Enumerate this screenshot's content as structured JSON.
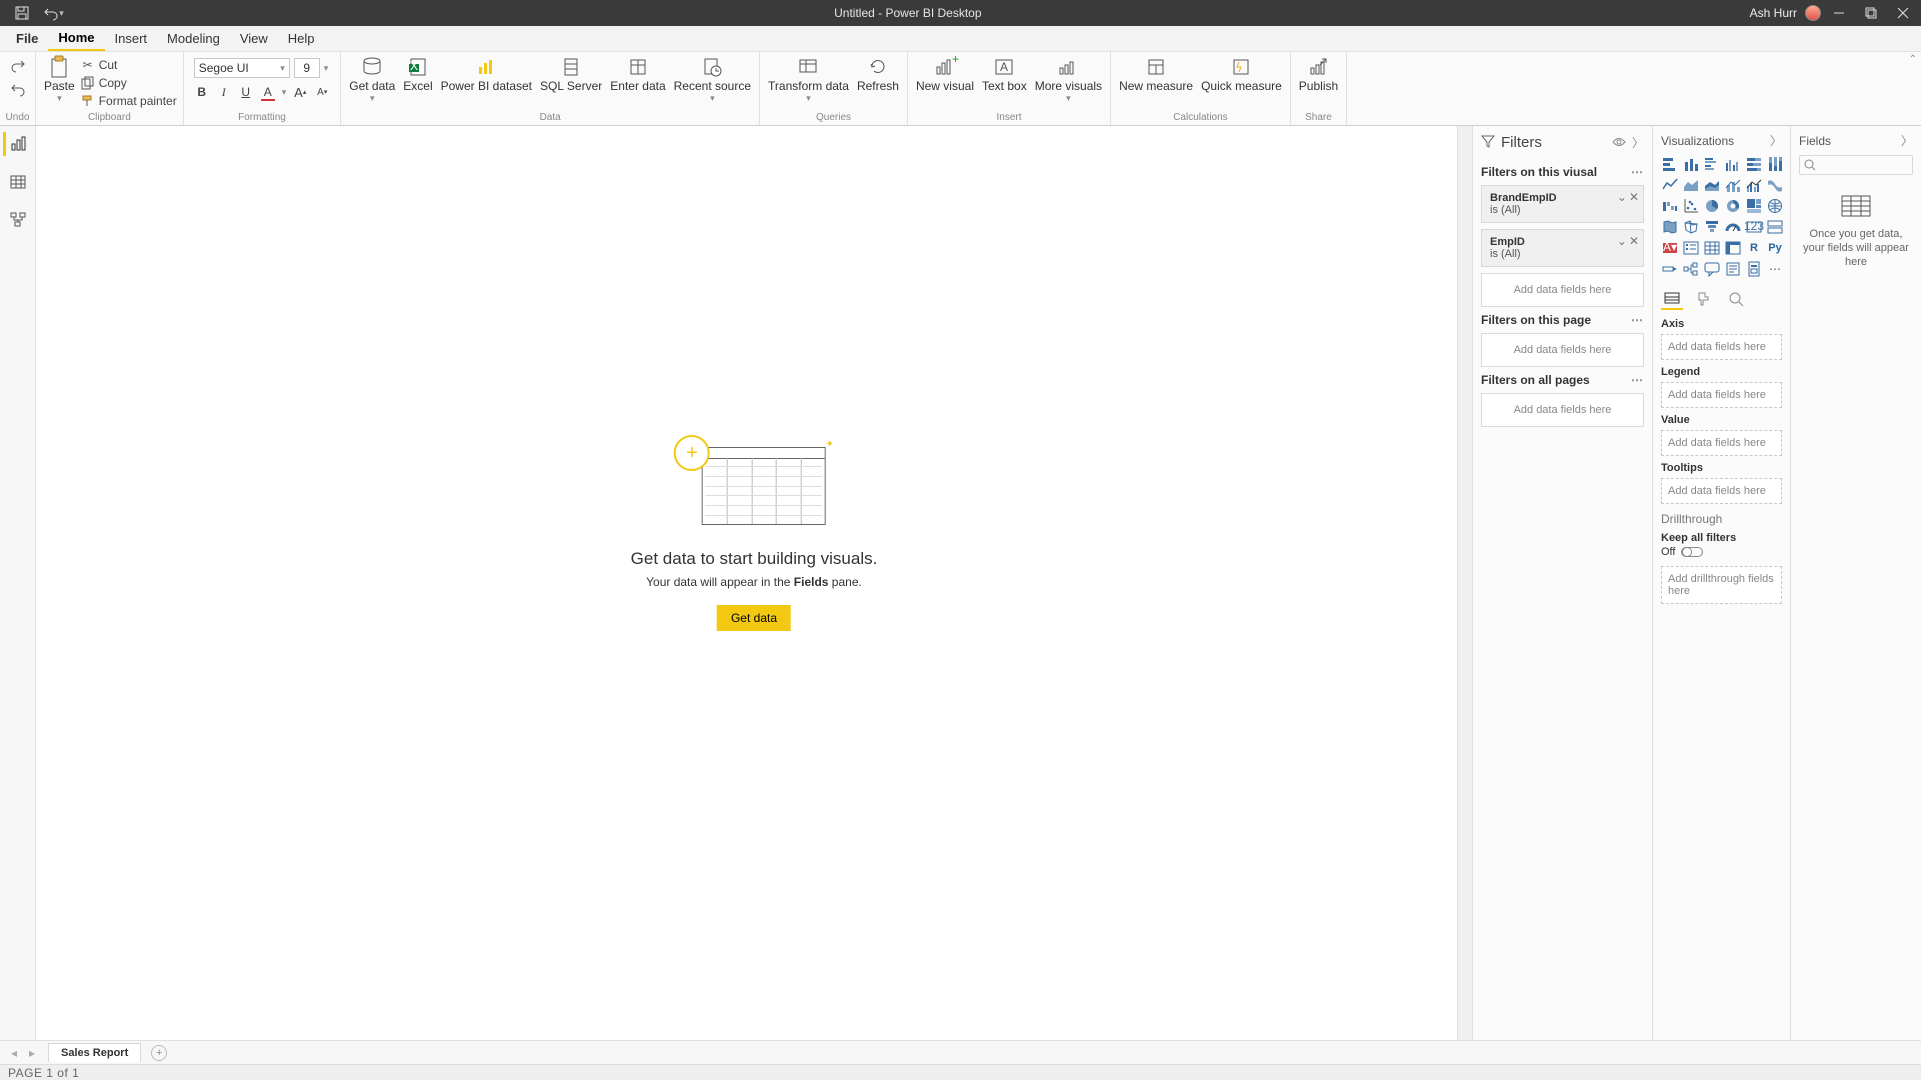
{
  "titlebar": {
    "title": "Untitled - Power BI Desktop",
    "user": "Ash Hurr"
  },
  "menus": {
    "file": "File",
    "home": "Home",
    "insert": "Insert",
    "modeling": "Modeling",
    "view": "View",
    "help": "Help"
  },
  "ribbon": {
    "undo_group": "Undo",
    "clipboard_group": "Clipboard",
    "formatting_group": "Formatting",
    "data_group": "Data",
    "queries_group": "Queries",
    "insert_group": "Insert",
    "calculations_group": "Calculations",
    "share_group": "Share",
    "paste": "Paste",
    "cut": "Cut",
    "copy": "Copy",
    "format_painter": "Format painter",
    "font_name": "Segoe UI",
    "font_size": "9",
    "get_data": "Get data",
    "excel": "Excel",
    "pbi_dataset": "Power BI dataset",
    "sql_server": "SQL Server",
    "enter_data": "Enter data",
    "recent_sources": "Recent source",
    "transform": "Transform data",
    "refresh": "Refresh",
    "new_visual": "New visual",
    "text_box": "Text box",
    "more_visuals": "More visuals",
    "new_measure": "New measure",
    "quick_measure": "Quick measure",
    "publish": "Publish"
  },
  "canvas": {
    "line1": "Get data to start building visuals.",
    "line2a": "Your data will appear in the ",
    "line2b": "Fields",
    "line2c": " pane.",
    "button": "Get data"
  },
  "filters": {
    "title": "Filters",
    "section_visual": "Filters on this viusal",
    "card1_name": "BrandEmpID",
    "card1_state": "is (All)",
    "card2_name": "EmpID",
    "card2_state": "is (All)",
    "add_here": "Add data fields here",
    "section_page": "Filters on this page",
    "section_all": "Filters on all pages"
  },
  "viz": {
    "title": "Visualizations",
    "axis": "Axis",
    "legend": "Legend",
    "value": "Value",
    "tooltips": "Tooltips",
    "well_placeholder": "Add data fields here",
    "drill_title": "Drillthrough",
    "keep_filters": "Keep all filters",
    "toggle_off": "Off",
    "drill_placeholder": "Add drillthrough fields here",
    "r_label": "R",
    "py_label": "Py"
  },
  "fields": {
    "title": "Fields",
    "message": "Once you get data, your fields will appear here"
  },
  "pagetabs": {
    "tab1": "Sales Report"
  },
  "status": {
    "text": "PAGE 1 of 1"
  }
}
